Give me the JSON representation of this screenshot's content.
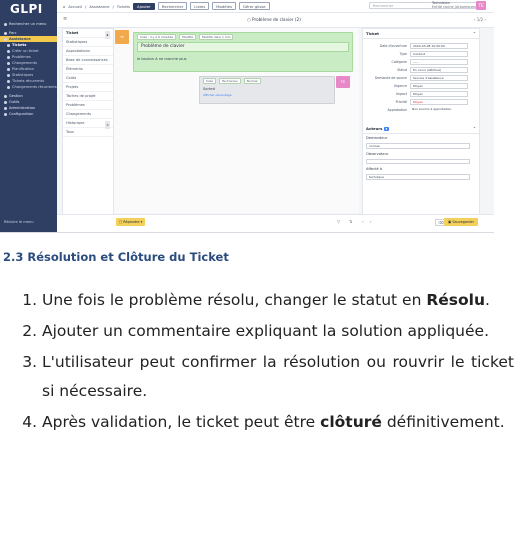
{
  "screenshot": {
    "logo": "GLPI",
    "sidebar": {
      "items": [
        {
          "label": "Rechercher un menu",
          "type": "top"
        },
        {
          "label": "Parc",
          "type": "top"
        },
        {
          "label": "Assistance",
          "type": "active"
        },
        {
          "label": "Tickets",
          "type": "sub selected"
        },
        {
          "label": "Créer un ticket",
          "type": "sub"
        },
        {
          "label": "Problèmes",
          "type": "sub"
        },
        {
          "label": "Changements",
          "type": "sub"
        },
        {
          "label": "Planification",
          "type": "sub"
        },
        {
          "label": "Statistiques",
          "type": "sub"
        },
        {
          "label": "Tickets récurrents",
          "type": "sub"
        },
        {
          "label": "Changements récurrents",
          "type": "sub"
        },
        {
          "label": "Gestion",
          "type": "top"
        },
        {
          "label": "Outils",
          "type": "top"
        },
        {
          "label": "Administration",
          "type": "top"
        },
        {
          "label": "Configuration",
          "type": "top"
        }
      ],
      "collapse_label": "Réduire le menu"
    },
    "topbar": {
      "breadcrumb": [
        "Accueil",
        "Assistance",
        "Tickets"
      ],
      "add_label": "Ajouter",
      "buttons": [
        "Rechercher",
        "Listes",
        "Modèles",
        "Gérer glisse"
      ],
      "search_placeholder": "Rechercher",
      "user_name": "Technicien",
      "user_entity": "Entité racine (Arborescence)",
      "avatar": "TE"
    },
    "subbar": {
      "title": "Problème de clavier (2)",
      "nav": "1/2"
    },
    "tabs": [
      {
        "label": "Ticket",
        "badge": "1",
        "active": true
      },
      {
        "label": "Statistiques"
      },
      {
        "label": "Approbations"
      },
      {
        "label": "Base de connaissances"
      },
      {
        "label": "Éléments"
      },
      {
        "label": "Coûts"
      },
      {
        "label": "Projets"
      },
      {
        "label": "Tâches de projet"
      },
      {
        "label": "Problèmes"
      },
      {
        "label": "Changements"
      },
      {
        "label": "Historique",
        "badge": "6"
      },
      {
        "label": "Tous"
      }
    ],
    "timeline": {
      "followup_avatar": "TE",
      "followup_meta": [
        "Créé : il y a 6 minutes",
        "Modifié",
        "Modifié dans 1 min"
      ],
      "followup_title": "Problème de clavier",
      "followup_text": "le bouton A ne marche plus",
      "reply_meta": [
        "Créé",
        "Technicien",
        "Normal"
      ],
      "reply_text": "Sorted",
      "reply_link": "Afficher davantage",
      "reply_avatar": "TE"
    },
    "panel": {
      "title": "Ticket",
      "fields": [
        {
          "label": "Date d'ouverture",
          "value": "2024-03-08 10:00:00"
        },
        {
          "label": "Type",
          "value": "Incident"
        },
        {
          "label": "Catégorie",
          "value": "-----"
        },
        {
          "label": "Statut",
          "value": "En cours (attribué)"
        },
        {
          "label": "Demande de source",
          "value": "Service d'assistance"
        },
        {
          "label": "Urgence",
          "value": "Moyen"
        },
        {
          "label": "Impact",
          "value": "Moyen"
        },
        {
          "label": "Priorité",
          "value": "Moyen",
          "red": true
        },
        {
          "label": "Approbation",
          "value": "Non soumis à approbation",
          "plain": true
        }
      ],
      "actors_title": "Acteurs",
      "actors_badge": "3",
      "requester_label": "Demandeur",
      "requester_value": "normal",
      "observer_label": "Observateur",
      "assigned_label": "Affecté à",
      "assigned_value": "technique"
    },
    "bottombar": {
      "reply_label": "Répondre",
      "save_label": "Sauvegarder"
    }
  },
  "doc": {
    "heading": "2.3 Résolution et Clôture du Ticket",
    "steps": [
      {
        "pre": "Une fois le problème résolu, changer le statut en ",
        "bold": "Résolu",
        "post": "."
      },
      {
        "pre": "Ajouter un commentaire expliquant la solution appliquée.",
        "bold": "",
        "post": ""
      },
      {
        "pre": "L'utilisateur peut confirmer la résolution ou rouvrir le ticket si nécessaire.",
        "bold": "",
        "post": ""
      },
      {
        "pre": "Après validation, le ticket peut être ",
        "bold": "clôturé",
        "post": " définitivement."
      }
    ]
  }
}
